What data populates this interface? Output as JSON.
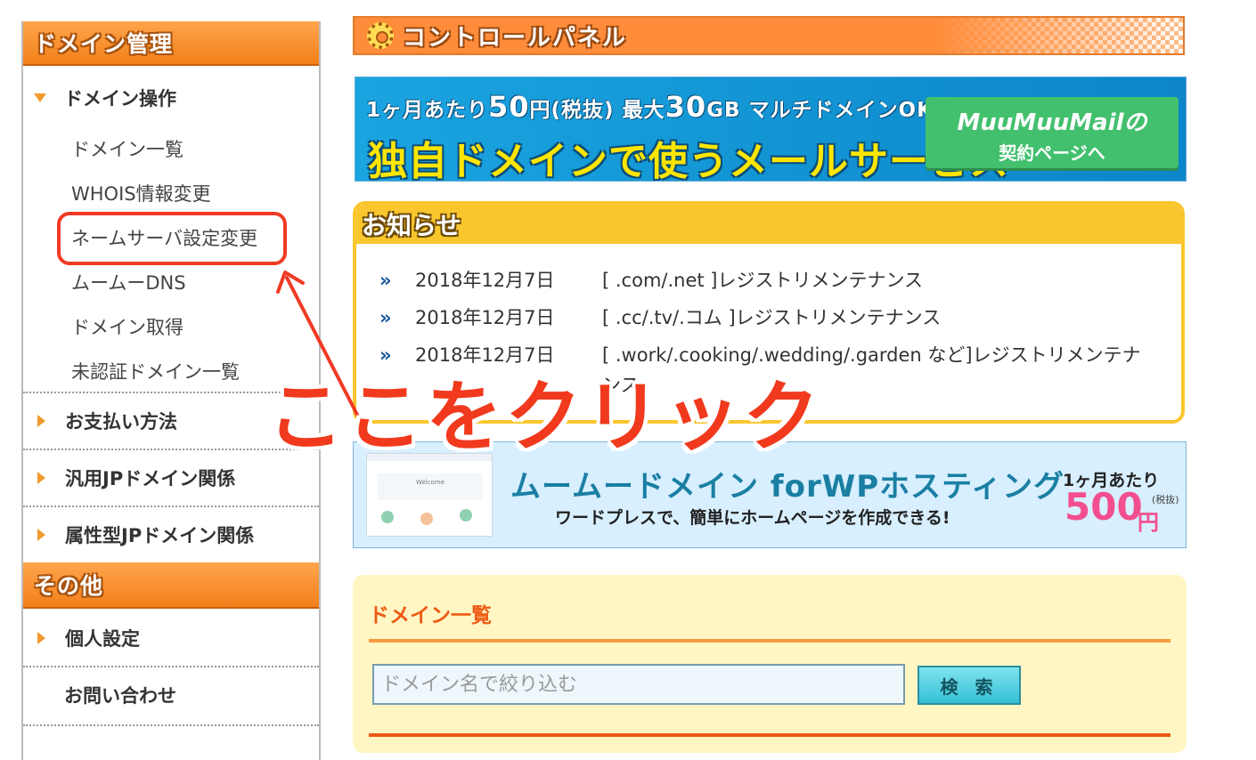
{
  "sidebar": {
    "heading_domain": "ドメイン管理",
    "domain_ops": {
      "title": "ドメイン操作",
      "items": [
        "ドメイン一覧",
        "WHOIS情報変更",
        "ネームサーバ設定変更",
        "ムームーDNS",
        "ドメイン取得",
        "未認証ドメイン一覧"
      ]
    },
    "payment": "お支払い方法",
    "jp_general": "汎用JPドメイン関係",
    "jp_attr": "属性型JPドメイン関係",
    "heading_other": "その他",
    "personal": "個人設定",
    "contact": "お問い合わせ"
  },
  "main": {
    "control_panel_title": "コントロールパネル",
    "mail_banner": {
      "top_pre": "1ヶ月あたり",
      "top_price": "50",
      "top_rest": "円(税抜) 最大",
      "top_size": "30",
      "top_tail": "GB マルチドメインOK!",
      "main": "独自ドメインで使うメールサービス",
      "button_line1": "MuuMuuMailの",
      "button_line2": "契約ページへ"
    },
    "news": {
      "heading": "お知らせ",
      "items": [
        {
          "date": "2018年12月7日",
          "title": "[ .com/.net ]レジストリメンテナンス"
        },
        {
          "date": "2018年12月7日",
          "title": "[ .cc/.tv/.コム ]レジストリメンテナンス"
        },
        {
          "date": "2018年12月7日",
          "title": "[ .work/.cooking/.wedding/.garden など]レジストリメンテナンス"
        }
      ]
    },
    "wp_banner": {
      "title": "ムームードメイン forWPホスティング",
      "subtitle": "ワードプレスで、簡単にホームページを作成できる!",
      "per_month": "1ヶ月あたり",
      "tax_note": "(税抜)",
      "price": "500",
      "yen": "円",
      "thumb_label": "Welcome"
    },
    "domain_list": {
      "title": "ドメイン一覧",
      "search_placeholder": "ドメイン名で絞り込む",
      "search_button": "検 索"
    }
  },
  "annotation": {
    "callout": "ここをクリック"
  },
  "colors": {
    "accent_orange": "#f2801a",
    "annotation_red": "#f03a24",
    "news_yellow": "#fac62d"
  }
}
